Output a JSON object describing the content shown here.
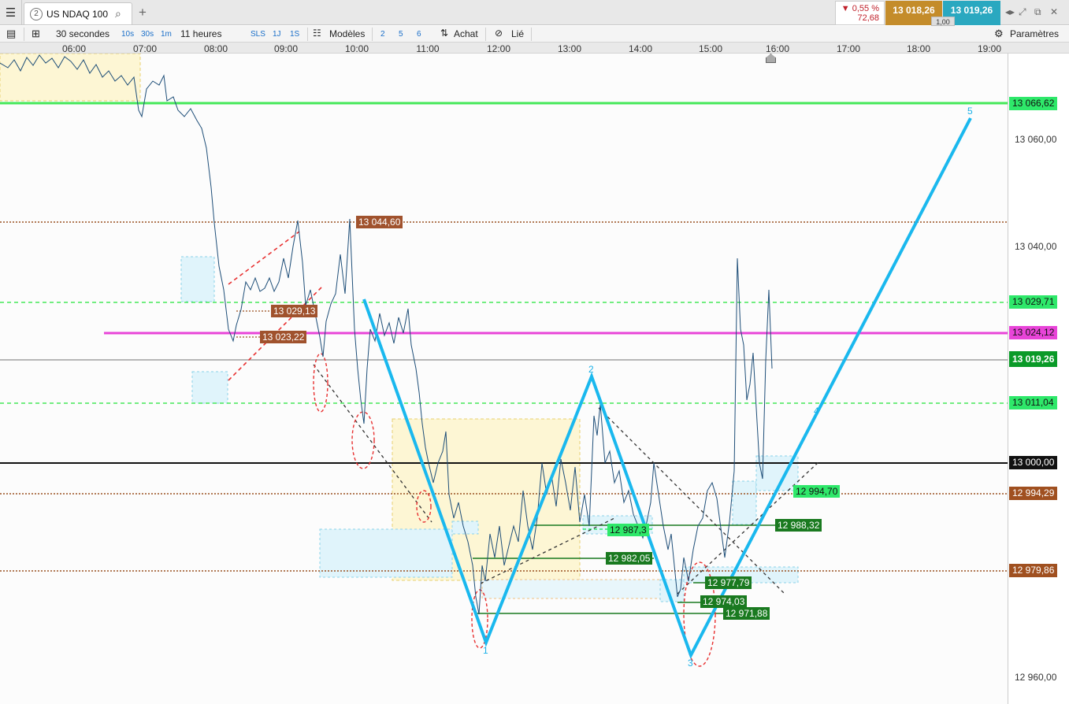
{
  "window": {
    "tab_number": "2",
    "tab_title": "US NDAQ 100",
    "icons": [
      "menu-icon",
      "search-icon",
      "add-tab-icon",
      "nav-arrows-icon",
      "expand-icon",
      "popout-icon",
      "close-icon"
    ]
  },
  "quote": {
    "change_pct": "▼ 0,55 %",
    "change_abs": "72,68",
    "bid": "13 018,26",
    "ask": "13 019,26",
    "spread": "1,00"
  },
  "toolbar": {
    "interval": "30 secondes",
    "intervals": [
      "10s",
      "30s",
      "1m"
    ],
    "duration": "11 heures",
    "ranges": [
      "SLS",
      "1J",
      "1S"
    ],
    "models": "Modèles",
    "counts": [
      "2",
      "5",
      "6"
    ],
    "buy": "Achat",
    "linked": "Lié",
    "settings": "Paramètres"
  },
  "time_axis": [
    "06:00",
    "07:00",
    "08:00",
    "09:00",
    "10:00",
    "11:00",
    "12:00",
    "13:00",
    "14:00",
    "15:00",
    "16:00",
    "17:00",
    "18:00",
    "19:00"
  ],
  "price_axis": {
    "ticks": [
      "13 060,00",
      "13 040,00",
      "12 960,00"
    ],
    "badges": [
      {
        "text": "13 066,62",
        "color": "#2ee86a"
      },
      {
        "text": "13 029,71",
        "color": "#2ee86a"
      },
      {
        "text": "13 024,12",
        "color": "#e844d8"
      },
      {
        "text": "13 019,26",
        "color": "#0a9a28"
      },
      {
        "text": "13 011,04",
        "color": "#2ee86a"
      },
      {
        "text": "13 000,00",
        "color": "#111111"
      },
      {
        "text": "12 994,29",
        "color": "#a05020"
      },
      {
        "text": "12 979,86",
        "color": "#a05020"
      }
    ]
  },
  "chart_labels": [
    {
      "text": "13 044,60",
      "color": "#a0522d"
    },
    {
      "text": "13 029,13",
      "color": "#a0522d"
    },
    {
      "text": "13 023,22",
      "color": "#a0522d"
    },
    {
      "text": "12 994,70",
      "color": "#2ee86a"
    },
    {
      "text": "12 988,32",
      "color": "#1a7a20"
    },
    {
      "text": "12 987,3",
      "color": "#2ee86a"
    },
    {
      "text": "12 982,05",
      "color": "#1a7a20"
    },
    {
      "text": "12 977,79",
      "color": "#1a7a20"
    },
    {
      "text": "12 974,03",
      "color": "#1a7a20"
    },
    {
      "text": "12 971,88",
      "color": "#1a7a20"
    }
  ],
  "wave_labels": [
    "1",
    "2",
    "3",
    "4",
    "5"
  ]
}
